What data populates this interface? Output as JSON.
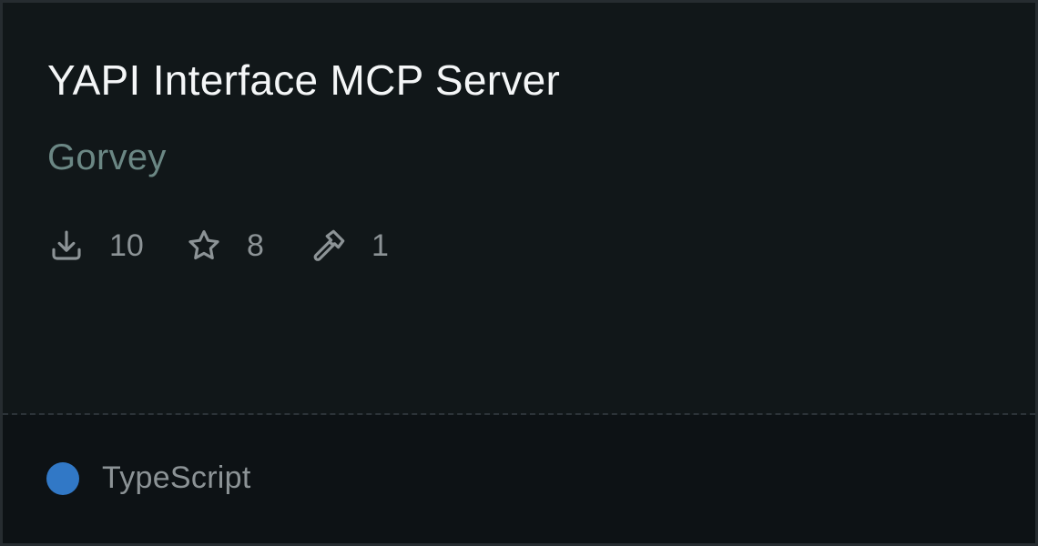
{
  "card": {
    "title": "YAPI Interface MCP Server",
    "author": "Gorvey",
    "stats": {
      "downloads": {
        "icon": "download-icon",
        "value": "10"
      },
      "stars": {
        "icon": "star-icon",
        "value": "8"
      },
      "tools": {
        "icon": "hammer-icon",
        "value": "1"
      }
    },
    "language": {
      "name": "TypeScript",
      "color": "#3178c6"
    }
  },
  "colors": {
    "background": "#111719",
    "footer_background": "#0d1215",
    "title": "#f4f6f7",
    "author": "#6b8784",
    "muted_text": "#8c9396"
  }
}
